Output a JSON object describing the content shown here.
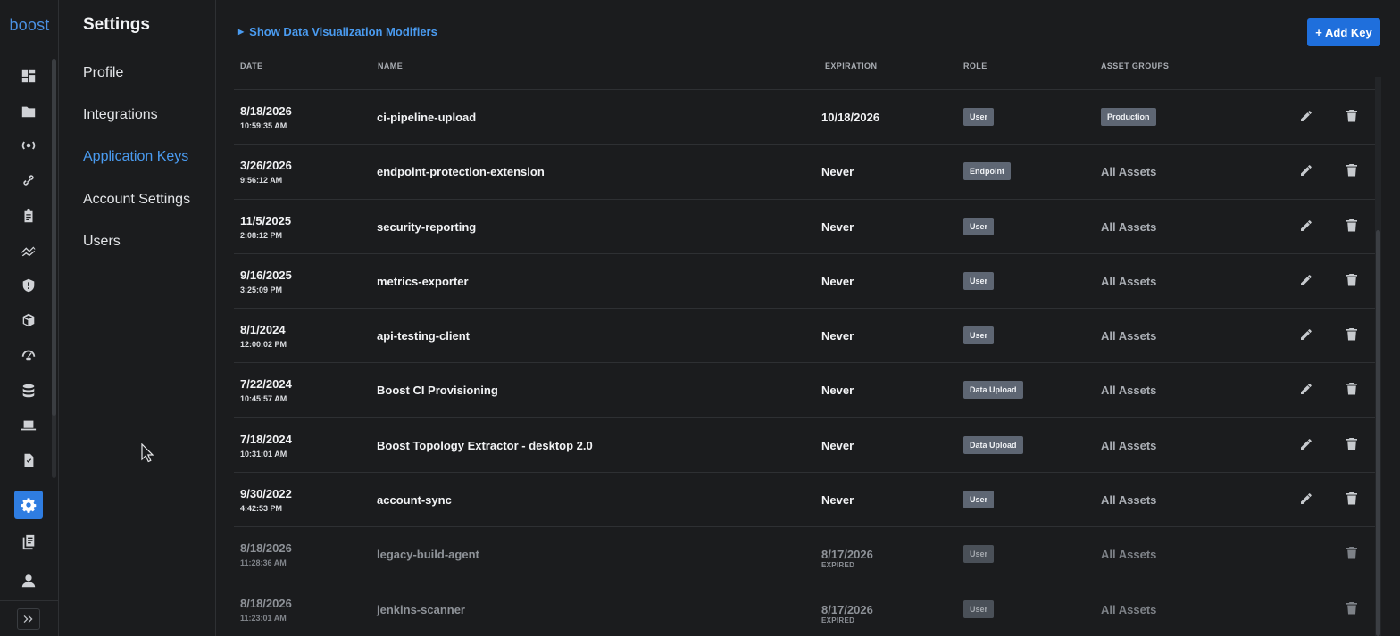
{
  "brand": {
    "logo_text": "boost"
  },
  "rail": {
    "icons": [
      "dashboard-icon",
      "folder-icon",
      "broadcast-icon",
      "link-icon",
      "clipboard-icon",
      "trend-icon",
      "shield-icon",
      "package-icon",
      "gauge-icon",
      "database-icon",
      "laptop-icon",
      "checklist-icon",
      "gear-icon",
      "documents-icon",
      "user-icon",
      "expand-icon"
    ],
    "active": "gear-icon"
  },
  "settings_nav": {
    "title": "Settings",
    "items": [
      {
        "label": "Profile",
        "active": false
      },
      {
        "label": "Integrations",
        "active": false
      },
      {
        "label": "Application Keys",
        "active": true
      },
      {
        "label": "Account Settings",
        "active": false
      },
      {
        "label": "Users",
        "active": false
      }
    ]
  },
  "main": {
    "modifiers_toggle": "Show Data Visualization Modifiers",
    "add_key_label": "+ Add Key",
    "columns": {
      "date": "DATE",
      "name": "NAME",
      "expiration": "EXPIRATION",
      "role": "ROLE",
      "asset_groups": "ASSET GROUPS"
    },
    "rows": [
      {
        "date": "8/18/2026",
        "time": "10:59:35 AM",
        "name": "ci-pipeline-upload",
        "expiration": "10/18/2026",
        "expiration_note": "",
        "role": "User",
        "asset_groups": "Production",
        "asset_is_tag": true,
        "expired": false
      },
      {
        "date": "3/26/2026",
        "time": "9:56:12 AM",
        "name": "endpoint-protection-extension",
        "expiration": "Never",
        "expiration_note": "",
        "role": "Endpoint",
        "asset_groups": "All Assets",
        "asset_is_tag": false,
        "expired": false
      },
      {
        "date": "11/5/2025",
        "time": "2:08:12 PM",
        "name": "security-reporting",
        "expiration": "Never",
        "expiration_note": "",
        "role": "User",
        "asset_groups": "All Assets",
        "asset_is_tag": false,
        "expired": false
      },
      {
        "date": "9/16/2025",
        "time": "3:25:09 PM",
        "name": "metrics-exporter",
        "expiration": "Never",
        "expiration_note": "",
        "role": "User",
        "asset_groups": "All Assets",
        "asset_is_tag": false,
        "expired": false
      },
      {
        "date": "8/1/2024",
        "time": "12:00:02 PM",
        "name": "api-testing-client",
        "expiration": "Never",
        "expiration_note": "",
        "role": "User",
        "asset_groups": "All Assets",
        "asset_is_tag": false,
        "expired": false
      },
      {
        "date": "7/22/2024",
        "time": "10:45:57 AM",
        "name": "Boost CI Provisioning",
        "expiration": "Never",
        "expiration_note": "",
        "role": "Data Upload",
        "asset_groups": "All Assets",
        "asset_is_tag": false,
        "expired": false
      },
      {
        "date": "7/18/2024",
        "time": "10:31:01 AM",
        "name": "Boost Topology Extractor - desktop 2.0",
        "expiration": "Never",
        "expiration_note": "",
        "role": "Data Upload",
        "asset_groups": "All Assets",
        "asset_is_tag": false,
        "expired": false
      },
      {
        "date": "9/30/2022",
        "time": "4:42:53 PM",
        "name": "account-sync",
        "expiration": "Never",
        "expiration_note": "",
        "role": "User",
        "asset_groups": "All Assets",
        "asset_is_tag": false,
        "expired": false
      },
      {
        "date": "8/18/2026",
        "time": "11:28:36 AM",
        "name": "legacy-build-agent",
        "expiration": "8/17/2026",
        "expiration_note": "EXPIRED",
        "role": "User",
        "asset_groups": "All Assets",
        "asset_is_tag": false,
        "expired": true
      },
      {
        "date": "8/18/2026",
        "time": "11:23:01 AM",
        "name": "jenkins-scanner",
        "expiration": "8/17/2026",
        "expiration_note": "EXPIRED",
        "role": "User",
        "asset_groups": "All Assets",
        "asset_is_tag": false,
        "expired": true
      }
    ]
  },
  "colors": {
    "accent": "#4a9bf0",
    "button": "#1f6fdc",
    "background": "#1b1c1e",
    "badge": "#5e6673"
  }
}
